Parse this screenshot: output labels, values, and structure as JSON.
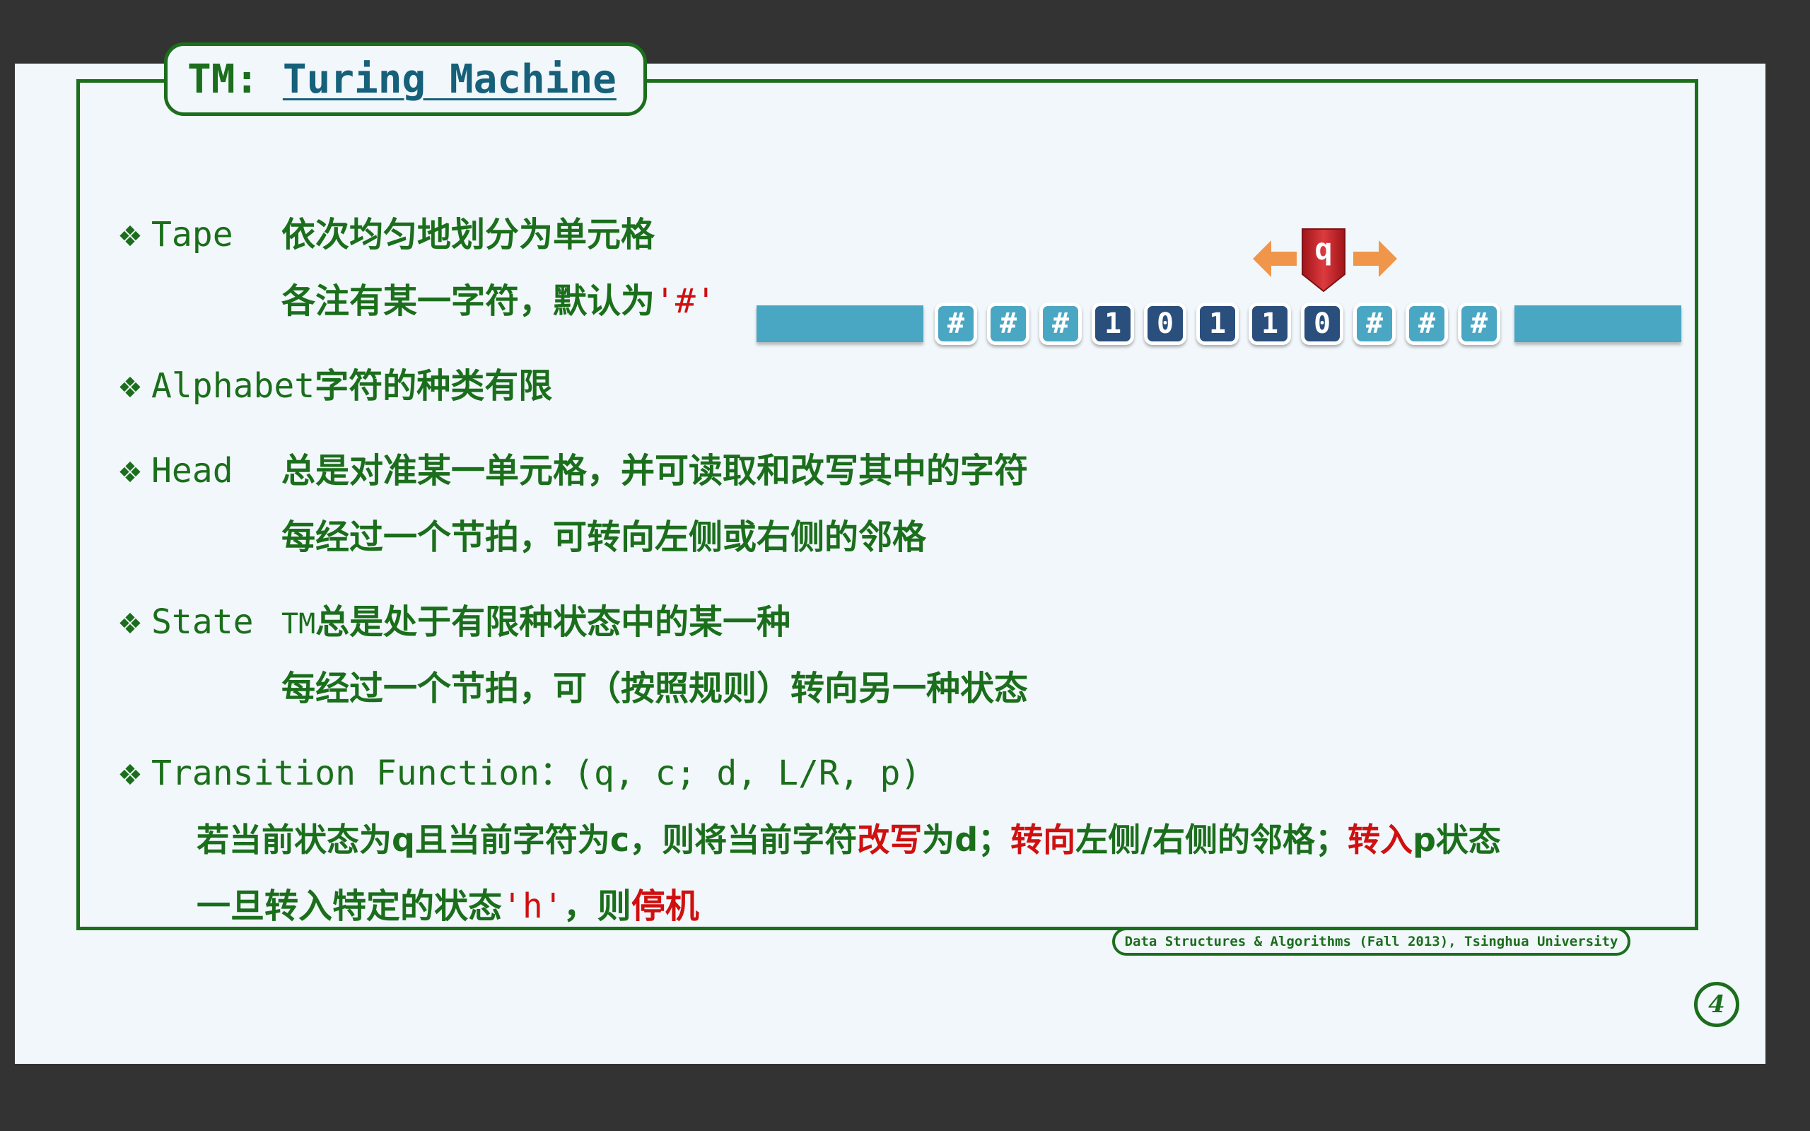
{
  "title": {
    "prefix": "TM: ",
    "link": "Turing Machine"
  },
  "sections": {
    "tape": {
      "keyword": "Tape",
      "line1": "依次均匀地划分为单元格",
      "line2_prefix": "各注有某一字符，默认为",
      "line2_symbol": "'#'"
    },
    "alphabet": {
      "keyword": "Alphabet",
      "line1": "字符的种类有限"
    },
    "head": {
      "keyword": "Head",
      "line1": "总是对准某一单元格，并可读取和改写其中的字符",
      "line2": "每经过一个节拍，可转向左侧或右侧的邻格"
    },
    "state": {
      "keyword": "State",
      "line1_prefix": "TM",
      "line1": "总是处于有限种状态中的某一种",
      "line2": "每经过一个节拍，可（按照规则）转向另一种状态"
    },
    "transition": {
      "keyword": "Transition Function",
      "signature": "：(q, c; d, L/R, p)",
      "line1_a": "若当前状态为q且当前字符为c，则将当前字符",
      "line1_b": "改写",
      "line1_c": "为d；",
      "line1_d": "转向",
      "line1_e": "左侧/右侧的邻格；",
      "line1_f": "转入",
      "line1_g": "p状态",
      "line2_a": "一旦转入特定的状态",
      "line2_b": "'h'",
      "line2_c": "，则",
      "line2_d": "停机"
    }
  },
  "tape_cells": [
    "#",
    "#",
    "#",
    "1",
    "0",
    "1",
    "1",
    "0",
    "#",
    "#",
    "#"
  ],
  "head_state": "q",
  "head_position_index": 7,
  "footer": "Data Structures & Algorithms (Fall 2013), Tsinghua University",
  "page_number": "4",
  "colors": {
    "green": "#1b6e1b",
    "red": "#d01010",
    "tape": "#4aa7c3",
    "bit": "#2a4f7c",
    "head": "#c8252b",
    "arrow": "#f0964a"
  }
}
